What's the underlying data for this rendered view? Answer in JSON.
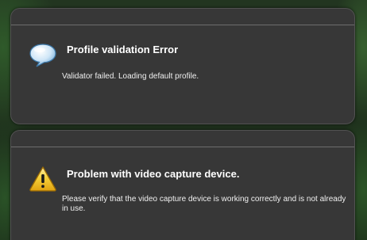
{
  "notifications": [
    {
      "icon": "speech-bubble-icon",
      "title": "Profile validation Error",
      "message": "Validator failed. Loading default profile."
    },
    {
      "icon": "warning-icon",
      "title": "Problem with video capture device.",
      "message": "Please verify that the video capture device is working correctly and is not already in use."
    }
  ],
  "colors": {
    "panel": "#373737",
    "separator": "#6d6d6d",
    "title_text": "#ffffff",
    "warning_fill": "#f0c419",
    "bubble_fill": "#cfe6f7"
  }
}
